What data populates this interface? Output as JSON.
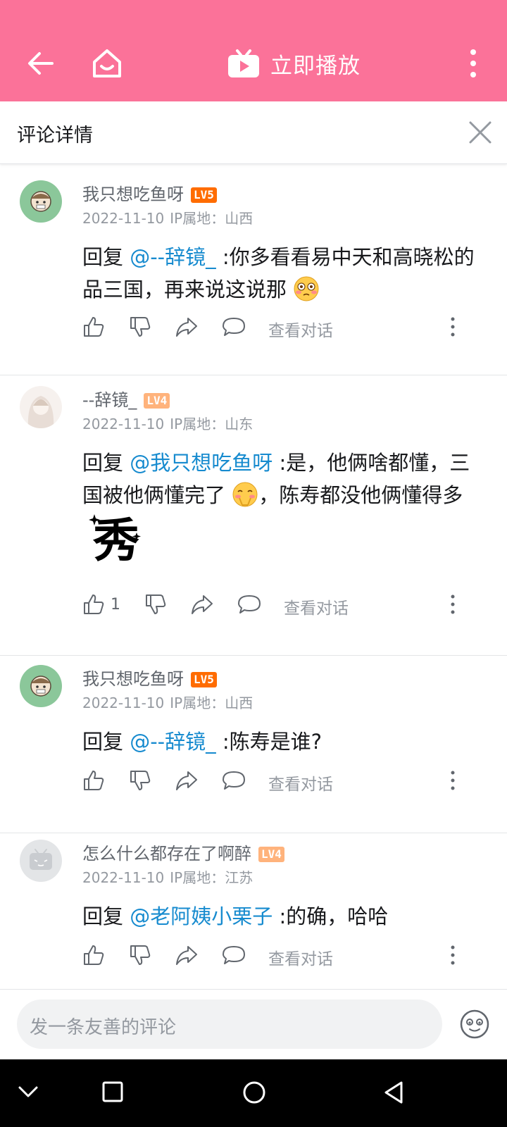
{
  "header": {
    "play_label": "立即播放"
  },
  "detail": {
    "title": "评论详情"
  },
  "comments": [
    {
      "user": "我只想吃鱼呀",
      "level": "LV5",
      "date": "2022-11-10",
      "ip": "IP属地：山西",
      "reply_prefix": "回复 ",
      "mention": "@--辞镜_",
      "text": " :你多看看易中天和高晓松的品三国，再来说这说那",
      "likes": "",
      "view_label": "查看对话"
    },
    {
      "user": "--辞镜_",
      "level": "LV4",
      "date": "2022-11-10",
      "ip": "IP属地：山东",
      "reply_prefix": "回复 ",
      "mention": "@我只想吃鱼呀",
      "text": " :是，他俩啥都懂，三国被他俩懂完了",
      "text2": "，陈寿都没他俩懂得多",
      "sticker": "秀",
      "likes": "1",
      "view_label": "查看对话"
    },
    {
      "user": "我只想吃鱼呀",
      "level": "LV5",
      "date": "2022-11-10",
      "ip": "IP属地：山西",
      "reply_prefix": "回复 ",
      "mention": "@--辞镜_",
      "text": " :陈寿是谁?",
      "likes": "",
      "view_label": "查看对话"
    },
    {
      "user": "怎么什么都存在了啊醉",
      "level": "LV4",
      "date": "2022-11-10",
      "ip": "IP属地：江苏",
      "reply_prefix": "回复 ",
      "mention": "@老阿姨小栗子",
      "text": " :的确，哈哈",
      "likes": "",
      "view_label": "查看对话"
    }
  ],
  "input": {
    "placeholder": "发一条友善的评论"
  },
  "colors": {
    "brand": "#fb7299",
    "mention": "#178bcf",
    "lv5": "#ff6c00",
    "lv4": "#ffb37c"
  },
  "icons": [
    "back-arrow-icon",
    "home-icon",
    "tv-play-icon",
    "more-vertical-icon",
    "close-icon",
    "thumb-up-icon",
    "thumb-down-icon",
    "share-icon",
    "reply-bubble-icon",
    "emoji-icon"
  ]
}
